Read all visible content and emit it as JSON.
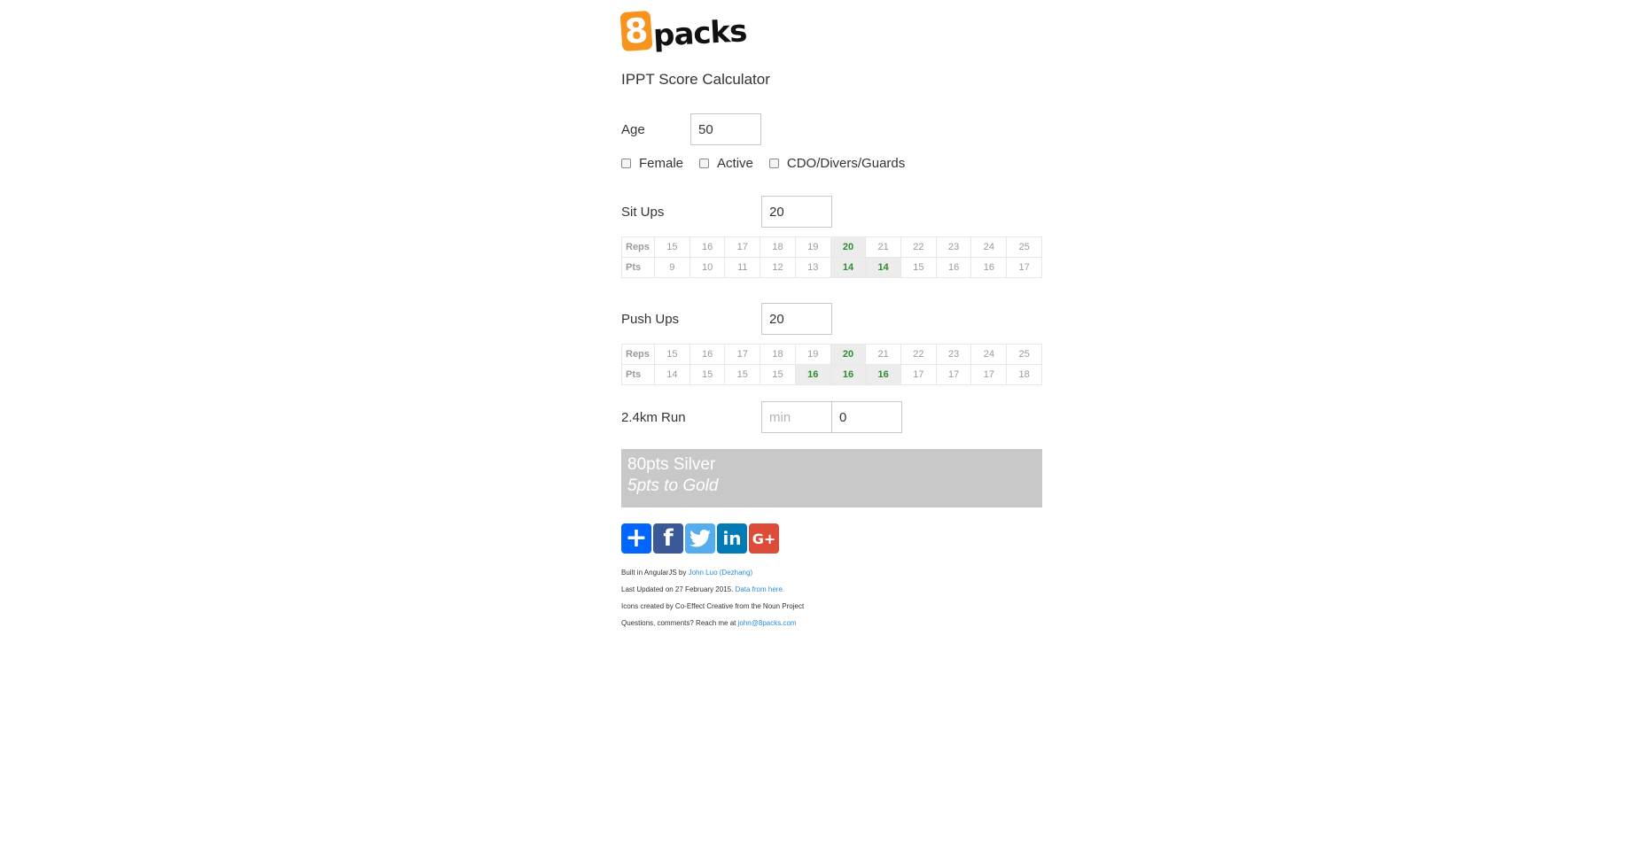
{
  "brand": {
    "badge": "8",
    "word": "packs",
    "badge_color": "#f7941d"
  },
  "app_title": "IPPT Score Calculator",
  "age": {
    "label": "Age",
    "value": "50"
  },
  "checkboxes": [
    {
      "label": "Female",
      "checked": false
    },
    {
      "label": "Active",
      "checked": false
    },
    {
      "label": "CDO/Divers/Guards",
      "checked": false
    }
  ],
  "situps": {
    "label": "Sit Ups",
    "value": "20",
    "table": {
      "reps_label": "Reps",
      "pts_label": "Pts",
      "reps": [
        "15",
        "16",
        "17",
        "18",
        "19",
        "20",
        "21",
        "22",
        "23",
        "24",
        "25"
      ],
      "pts": [
        "9",
        "10",
        "11",
        "12",
        "13",
        "14",
        "14",
        "15",
        "16",
        "16",
        "17"
      ],
      "reps_highlight": [
        5
      ],
      "pts_highlight": [
        5,
        6
      ]
    }
  },
  "pushups": {
    "label": "Push Ups",
    "value": "20",
    "table": {
      "reps_label": "Reps",
      "pts_label": "Pts",
      "reps": [
        "15",
        "16",
        "17",
        "18",
        "19",
        "20",
        "21",
        "22",
        "23",
        "24",
        "25"
      ],
      "pts": [
        "14",
        "15",
        "15",
        "15",
        "16",
        "16",
        "16",
        "17",
        "17",
        "17",
        "18"
      ],
      "reps_highlight": [
        5
      ],
      "pts_highlight": [
        4,
        5,
        6
      ]
    }
  },
  "run": {
    "label": "2.4km Run",
    "min_placeholder": "min",
    "sec_value": "0"
  },
  "result": {
    "score": "80pts Silver",
    "next": "5pts to Gold"
  },
  "share": {
    "buttons": [
      {
        "name": "share-add",
        "glyph": "+",
        "icon": "plus-icon"
      },
      {
        "name": "share-facebook",
        "glyph": "f",
        "icon": "facebook-icon"
      },
      {
        "name": "share-twitter",
        "glyph": "",
        "icon": "twitter-icon"
      },
      {
        "name": "share-linkedin",
        "glyph": "in",
        "icon": "linkedin-icon"
      },
      {
        "name": "share-googleplus",
        "glyph": "G+",
        "icon": "google-plus-icon"
      }
    ]
  },
  "footer": {
    "built_prefix": "Built in AngularJS by ",
    "built_link": "John Luo (Dezhang)",
    "updated_prefix": "Last Updated on 27 February 2015. ",
    "updated_link": "Data from here.",
    "icons_credit": "Icons created by Co-Effect Creative from the Noun Project",
    "contact_prefix": "Questions, comments? Reach me at ",
    "contact_link": "john@8packs.com"
  }
}
